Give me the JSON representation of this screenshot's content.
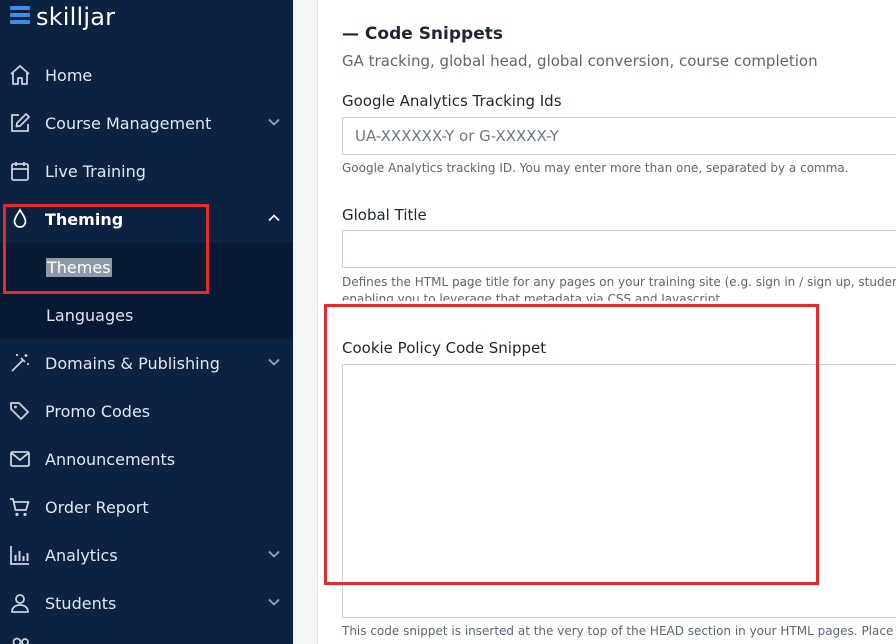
{
  "brand": {
    "name": "skilljar"
  },
  "sidebar": {
    "items": [
      {
        "label": "Home",
        "icon": "home-icon",
        "has_chevron": false
      },
      {
        "label": "Course Management",
        "icon": "edit-icon",
        "has_chevron": true
      },
      {
        "label": "Live Training",
        "icon": "calendar-icon",
        "has_chevron": false
      },
      {
        "label": "Theming",
        "icon": "droplet-icon",
        "has_chevron": true,
        "expanded": true
      },
      {
        "label": "Domains & Publishing",
        "icon": "magic-wand-icon",
        "has_chevron": true
      },
      {
        "label": "Promo Codes",
        "icon": "tags-icon",
        "has_chevron": false
      },
      {
        "label": "Announcements",
        "icon": "envelope-icon",
        "has_chevron": false
      },
      {
        "label": "Order Report",
        "icon": "cart-icon",
        "has_chevron": false
      },
      {
        "label": "Analytics",
        "icon": "bar-chart-icon",
        "has_chevron": true
      },
      {
        "label": "Students",
        "icon": "user-icon",
        "has_chevron": true
      }
    ],
    "theming_sub": [
      {
        "label": "Themes",
        "selected": true
      },
      {
        "label": "Languages",
        "selected": false
      }
    ]
  },
  "main": {
    "section_title": "— Code Snippets",
    "section_subtitle": "GA tracking, global head, global conversion, course completion",
    "ga": {
      "label": "Google Analytics Tracking Ids",
      "placeholder": "UA-XXXXXX-Y or G-XXXXX-Y",
      "help": "Google Analytics tracking ID. You may enter more than one, separated by a comma."
    },
    "global_title": {
      "label": "Global Title",
      "value": "",
      "help_line1": "Defines the HTML page title for any pages on your training site (e.g. sign in / sign up, student",
      "help_line2": "enabling you to leverage that metadata via CSS and Javascript."
    },
    "cookie": {
      "label": "Cookie Policy Code Snippet",
      "value": "",
      "help": "This code snippet is inserted at the very top of the HEAD section in your HTML pages. Place y"
    }
  },
  "colors": {
    "sidebar_bg": "#0b2240",
    "submenu_bg": "#081a33",
    "accent": "#3b8fe8",
    "highlight": "#e52b2b"
  }
}
